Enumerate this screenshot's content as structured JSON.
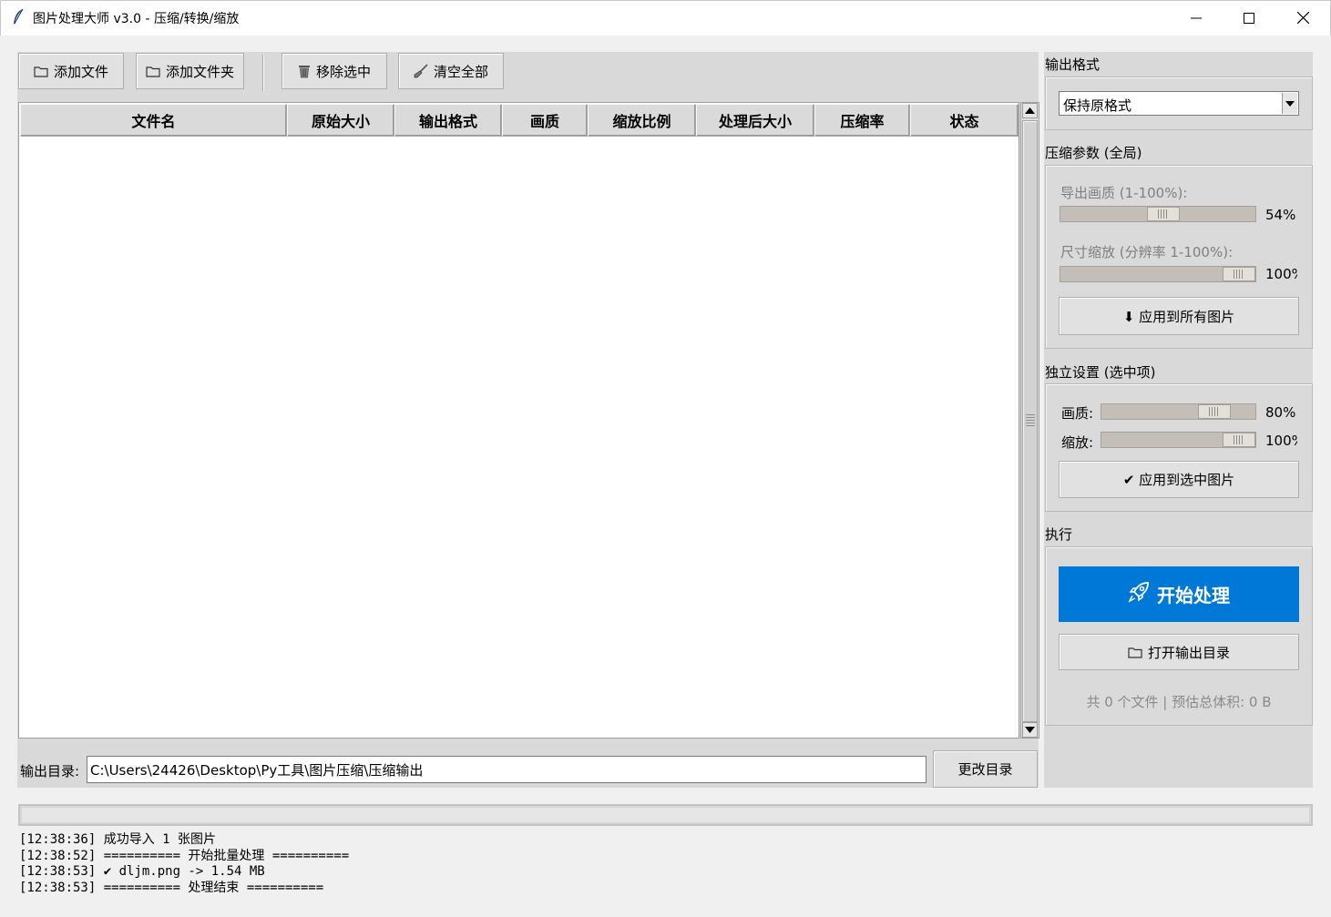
{
  "window": {
    "title": "图片处理大师 v3.0 - 压缩/转换/缩放",
    "icon": "feather-icon"
  },
  "toolbar": {
    "add_file": "添加文件",
    "add_folder": "添加文件夹",
    "remove_selected": "移除选中",
    "clear_all": "清空全部"
  },
  "table": {
    "columns": [
      "文件名",
      "原始大小",
      "输出格式",
      "画质",
      "缩放比例",
      "处理后大小",
      "压缩率",
      "状态"
    ],
    "rows": []
  },
  "output": {
    "label": "输出目录:",
    "path": "C:\\Users\\24426\\Desktop\\Py工具\\图片压缩\\压缩输出",
    "change_button": "更改目录"
  },
  "progress": {
    "percent": 0
  },
  "log": [
    "[12:38:36] 成功导入 1 张图片",
    "[12:38:52] ========== 开始批量处理 ==========",
    "[12:38:53] ✔ dljm.png -> 1.54 MB",
    "[12:38:53] ========== 处理结束 =========="
  ],
  "format_section": {
    "title": "输出格式",
    "selected": "保持原格式"
  },
  "global_params": {
    "title": "压缩参数 (全局)",
    "quality_label": "导出画质 (1-100%):",
    "quality_value": 54,
    "quality_text": "54%",
    "scale_label": "尺寸缩放 (分辨率 1-100%):",
    "scale_value": 100,
    "scale_text": "100%",
    "apply_all_button": "⬇ 应用到所有图片"
  },
  "individual": {
    "title": "独立设置 (选中项)",
    "quality_label": "画质:",
    "quality_value": 80,
    "quality_text": "80%",
    "scale_label": "缩放:",
    "scale_value": 100,
    "scale_text": "100%",
    "apply_selected_button": "✔ 应用到选中图片"
  },
  "execute": {
    "title": "执行",
    "start_button": "开始处理",
    "open_output_button": "打开输出目录",
    "summary": "共 0 个文件 | 预估总体积: 0 B"
  },
  "colors": {
    "primary": "#0078d7",
    "panel": "#d9d9d9",
    "window_bg": "#f0f0f0"
  }
}
